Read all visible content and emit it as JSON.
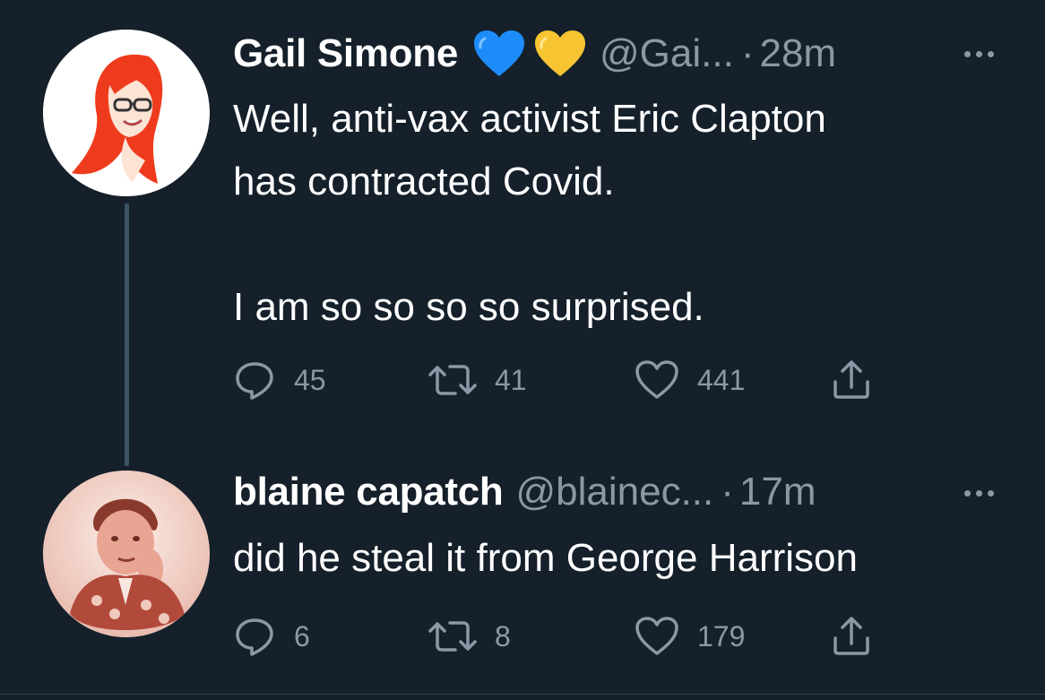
{
  "tweets": [
    {
      "display_name": "Gail Simone",
      "emojis": [
        "blue-heart-icon",
        "yellow-heart-icon"
      ],
      "handle": "@Gai...",
      "separator": "·",
      "time": "28m",
      "lines": [
        "Well, anti-vax activist Eric Clapton",
        "has contracted Covid.",
        "",
        "I am so so so so surprised."
      ],
      "replies": "45",
      "retweets": "41",
      "likes": "441"
    },
    {
      "display_name": "blaine capatch",
      "handle": "@blainec...",
      "separator": "·",
      "time": "17m",
      "lines": [
        "did he steal it from George Harrison"
      ],
      "replies": "6",
      "retweets": "8",
      "likes": "179"
    }
  ],
  "colors": {
    "background": "#15202b",
    "text": "#ffffff",
    "muted": "#8b98a5",
    "thread_line": "#3d5466",
    "blue_heart": "#1d8cf8",
    "yellow_heart": "#f7c531"
  }
}
